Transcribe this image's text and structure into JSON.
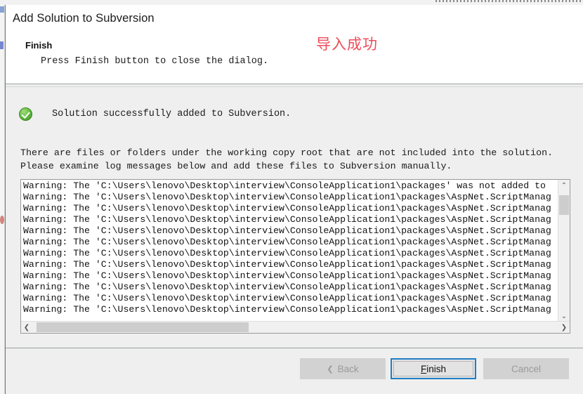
{
  "window": {
    "title": "Add Solution to Subversion"
  },
  "header": {
    "step_name": "Finish",
    "step_description": "Press Finish button to close the dialog.",
    "annotation": "导入成功",
    "annotation_color": "#ef4b5a"
  },
  "body": {
    "success_icon": "green-check-circle-icon",
    "success_message": "Solution successfully added to Subversion.",
    "warning_line_1": "There are files or folders under the working copy root that are not included into the solution.",
    "warning_line_2": "Please examine log messages below and add these files to Subversion manually."
  },
  "log": {
    "lines": [
      "Warning: The 'C:\\Users\\lenovo\\Desktop\\interview\\ConsoleApplication1\\packages' was not added to",
      "Warning: The 'C:\\Users\\lenovo\\Desktop\\interview\\ConsoleApplication1\\packages\\AspNet.ScriptManag",
      "Warning: The 'C:\\Users\\lenovo\\Desktop\\interview\\ConsoleApplication1\\packages\\AspNet.ScriptManag",
      "Warning: The 'C:\\Users\\lenovo\\Desktop\\interview\\ConsoleApplication1\\packages\\AspNet.ScriptManag",
      "Warning: The 'C:\\Users\\lenovo\\Desktop\\interview\\ConsoleApplication1\\packages\\AspNet.ScriptManag",
      "Warning: The 'C:\\Users\\lenovo\\Desktop\\interview\\ConsoleApplication1\\packages\\AspNet.ScriptManag",
      "Warning: The 'C:\\Users\\lenovo\\Desktop\\interview\\ConsoleApplication1\\packages\\AspNet.ScriptManag",
      "Warning: The 'C:\\Users\\lenovo\\Desktop\\interview\\ConsoleApplication1\\packages\\AspNet.ScriptManag",
      "Warning: The 'C:\\Users\\lenovo\\Desktop\\interview\\ConsoleApplication1\\packages\\AspNet.ScriptManag",
      "Warning: The 'C:\\Users\\lenovo\\Desktop\\interview\\ConsoleApplication1\\packages\\AspNet.ScriptManag",
      "Warning: The 'C:\\Users\\lenovo\\Desktop\\interview\\ConsoleApplication1\\packages\\AspNet.ScriptManag",
      "Warning: The 'C:\\Users\\lenovo\\Desktop\\interview\\ConsoleApplication1\\packages\\AspNet.ScriptManag"
    ],
    "scroll_up_glyph": "⌃",
    "scroll_down_glyph": "⌄",
    "scroll_left_glyph": "❮",
    "scroll_right_glyph": "❯"
  },
  "footer": {
    "back_chevron": "❮",
    "back_label": "Back",
    "finish_label_mnemonic": "F",
    "finish_label_rest": "inish",
    "cancel_label": "Cancel"
  }
}
